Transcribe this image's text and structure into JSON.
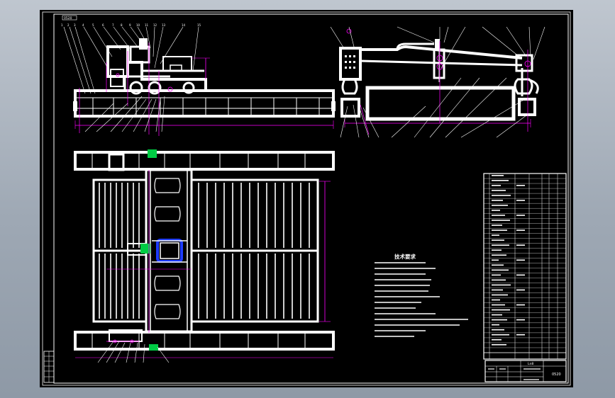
{
  "drawing": {
    "border_tag": "0520",
    "notes_title": "技术要求",
    "title_block": {
      "name_cell": "Ln8",
      "code_cell": "0520"
    }
  },
  "colors": {
    "background": "#000000",
    "lines": "#ffffff",
    "dimensions": "#ff00ff",
    "accent_green": "#00cc44",
    "accent_blue": "#1e3cff",
    "viewport": "#9ea8b4"
  }
}
